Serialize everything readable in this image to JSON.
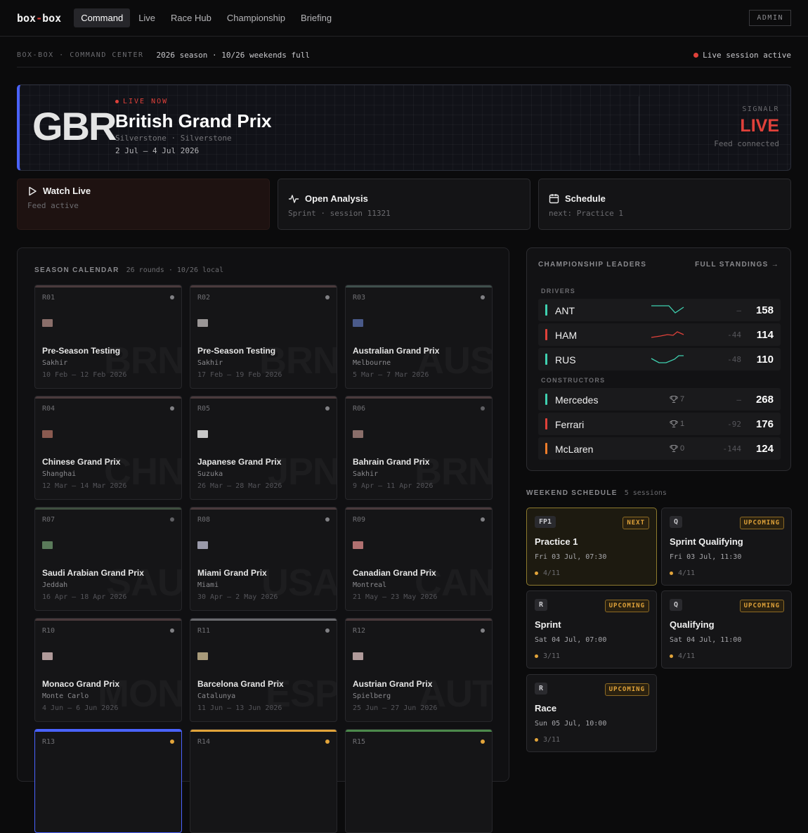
{
  "nav": {
    "logo_left": "box",
    "logo_dash": "-",
    "logo_right": "box",
    "tabs": [
      "Command",
      "Live",
      "Race Hub",
      "Championship",
      "Briefing"
    ],
    "admin": "ADMIN"
  },
  "subheader": {
    "crumb": "BOX-BOX · COMMAND CENTER",
    "season": "2026 season · 10/26 weekends full",
    "live": "Live session active"
  },
  "hero": {
    "code": "GBR",
    "live_label": "LIVE NOW",
    "title": "British Grand Prix",
    "location": "Silverstone · Silverstone",
    "dates": "2 Jul – 4 Jul 2026",
    "signal_label": "SIGNALR",
    "signal_value": "LIVE",
    "signal_status": "Feed connected"
  },
  "actions": [
    {
      "label": "Watch Live",
      "sub": "Feed active"
    },
    {
      "label": "Open Analysis",
      "sub": "Sprint · session 11321"
    },
    {
      "label": "Schedule",
      "sub": "next: Practice 1"
    }
  ],
  "calendar": {
    "title": "SEASON CALENDAR",
    "sub": "26 rounds · 10/26 local",
    "rounds": [
      {
        "round": "R01",
        "name": "Pre-Season Testing",
        "city": "Sakhir",
        "dates": "10 Feb – 12 Feb 2026",
        "wm": "BRN",
        "bar": "#4a3a3c",
        "flag": "#8a6e6a",
        "dot": "#808084"
      },
      {
        "round": "R02",
        "name": "Pre-Season Testing",
        "city": "Sakhir",
        "dates": "17 Feb – 19 Feb 2026",
        "wm": "BRN",
        "bar": "#4a3a3c",
        "flag": "#9a9696",
        "dot": "#808084"
      },
      {
        "round": "R03",
        "name": "Australian Grand Prix",
        "city": "Melbourne",
        "dates": "5 Mar – 7 Mar 2026",
        "wm": "AUS",
        "bar": "#3f4f4c",
        "flag": "#4a5a8a",
        "dot": "#808084"
      },
      {
        "round": "R04",
        "name": "Chinese Grand Prix",
        "city": "Shanghai",
        "dates": "12 Mar – 14 Mar 2026",
        "wm": "CHN",
        "bar": "#4a3a3c",
        "flag": "#8a5a50",
        "dot": "#808084"
      },
      {
        "round": "R05",
        "name": "Japanese Grand Prix",
        "city": "Suzuka",
        "dates": "26 Mar – 28 Mar 2026",
        "wm": "JPN",
        "bar": "#4a3a3c",
        "flag": "#c8c8c8",
        "dot": "#808084"
      },
      {
        "round": "R06",
        "name": "Bahrain Grand Prix",
        "city": "Sakhir",
        "dates": "9 Apr – 11 Apr 2026",
        "wm": "BRN",
        "bar": "#4a3a3c",
        "flag": "#8a6e6a",
        "dot": "#606064"
      },
      {
        "round": "R07",
        "name": "Saudi Arabian Grand Prix",
        "city": "Jeddah",
        "dates": "16 Apr – 18 Apr 2026",
        "wm": "SAU",
        "bar": "#3f4f3f",
        "flag": "#5a7a5a",
        "dot": "#606064"
      },
      {
        "round": "R08",
        "name": "Miami Grand Prix",
        "city": "Miami",
        "dates": "30 Apr – 2 May 2026",
        "wm": "USA",
        "bar": "#4a3a3c",
        "flag": "#9a9aaa",
        "dot": "#808084"
      },
      {
        "round": "R09",
        "name": "Canadian Grand Prix",
        "city": "Montreal",
        "dates": "21 May – 23 May 2026",
        "wm": "CAN",
        "bar": "#4a3a3c",
        "flag": "#b07070",
        "dot": "#808084"
      },
      {
        "round": "R10",
        "name": "Monaco Grand Prix",
        "city": "Monte Carlo",
        "dates": "4 Jun – 6 Jun 2026",
        "wm": "MON",
        "bar": "#4a3a3c",
        "flag": "#b09a9a",
        "dot": "#808084"
      },
      {
        "round": "R11",
        "name": "Barcelona Grand Prix",
        "city": "Catalunya",
        "dates": "11 Jun – 13 Jun 2026",
        "wm": "ESP",
        "bar": "#6a6a6e",
        "flag": "#a89a7a",
        "dot": "#808084"
      },
      {
        "round": "R12",
        "name": "Austrian Grand Prix",
        "city": "Spielberg",
        "dates": "25 Jun – 27 Jun 2026",
        "wm": "AUT",
        "bar": "#4a3a3c",
        "flag": "#b09a9a",
        "dot": "#808084"
      },
      {
        "round": "R13",
        "name": "",
        "city": "",
        "dates": "",
        "wm": "",
        "bar": "#4a63ff",
        "flag": "transparent",
        "dot": "#e2a43a"
      },
      {
        "round": "R14",
        "name": "",
        "city": "",
        "dates": "",
        "wm": "",
        "bar": "#e2a43a",
        "flag": "transparent",
        "dot": "#e2a43a"
      },
      {
        "round": "R15",
        "name": "",
        "city": "",
        "dates": "",
        "wm": "",
        "bar": "#4c8a4c",
        "flag": "transparent",
        "dot": "#e2a43a"
      }
    ]
  },
  "leaders": {
    "title": "CHAMPIONSHIP LEADERS",
    "link": "FULL STANDINGS →",
    "drivers_label": "DRIVERS",
    "constructors_label": "CONSTRUCTORS",
    "drivers": [
      {
        "name": "ANT",
        "gap": "—",
        "points": "158",
        "color": "#3fd1b0"
      },
      {
        "name": "HAM",
        "gap": "-44",
        "points": "114",
        "color": "#e0413a"
      },
      {
        "name": "RUS",
        "gap": "-48",
        "points": "110",
        "color": "#3fd1b0"
      }
    ],
    "constructors": [
      {
        "name": "Mercedes",
        "wins": "7",
        "gap": "—",
        "points": "268",
        "color": "#3fd1b0"
      },
      {
        "name": "Ferrari",
        "wins": "1",
        "gap": "-92",
        "points": "176",
        "color": "#e0413a"
      },
      {
        "name": "McLaren",
        "wins": "0",
        "gap": "-144",
        "points": "124",
        "color": "#ee7d2a"
      }
    ]
  },
  "schedule": {
    "title": "WEEKEND SCHEDULE",
    "sub": "5 sessions",
    "sessions": [
      {
        "code": "FP1",
        "badge": "NEXT",
        "name": "Practice 1",
        "time": "Fri 03 Jul, 07:30",
        "count": "4/11",
        "next": true
      },
      {
        "code": "Q",
        "badge": "UPCOMING",
        "name": "Sprint Qualifying",
        "time": "Fri 03 Jul, 11:30",
        "count": "4/11",
        "next": false
      },
      {
        "code": "R",
        "badge": "UPCOMING",
        "name": "Sprint",
        "time": "Sat 04 Jul, 07:00",
        "count": "3/11",
        "next": false
      },
      {
        "code": "Q",
        "badge": "UPCOMING",
        "name": "Qualifying",
        "time": "Sat 04 Jul, 11:00",
        "count": "4/11",
        "next": false
      },
      {
        "code": "R",
        "badge": "UPCOMING",
        "name": "Race",
        "time": "Sun 05 Jul, 10:00",
        "count": "3/11",
        "next": false
      }
    ]
  }
}
